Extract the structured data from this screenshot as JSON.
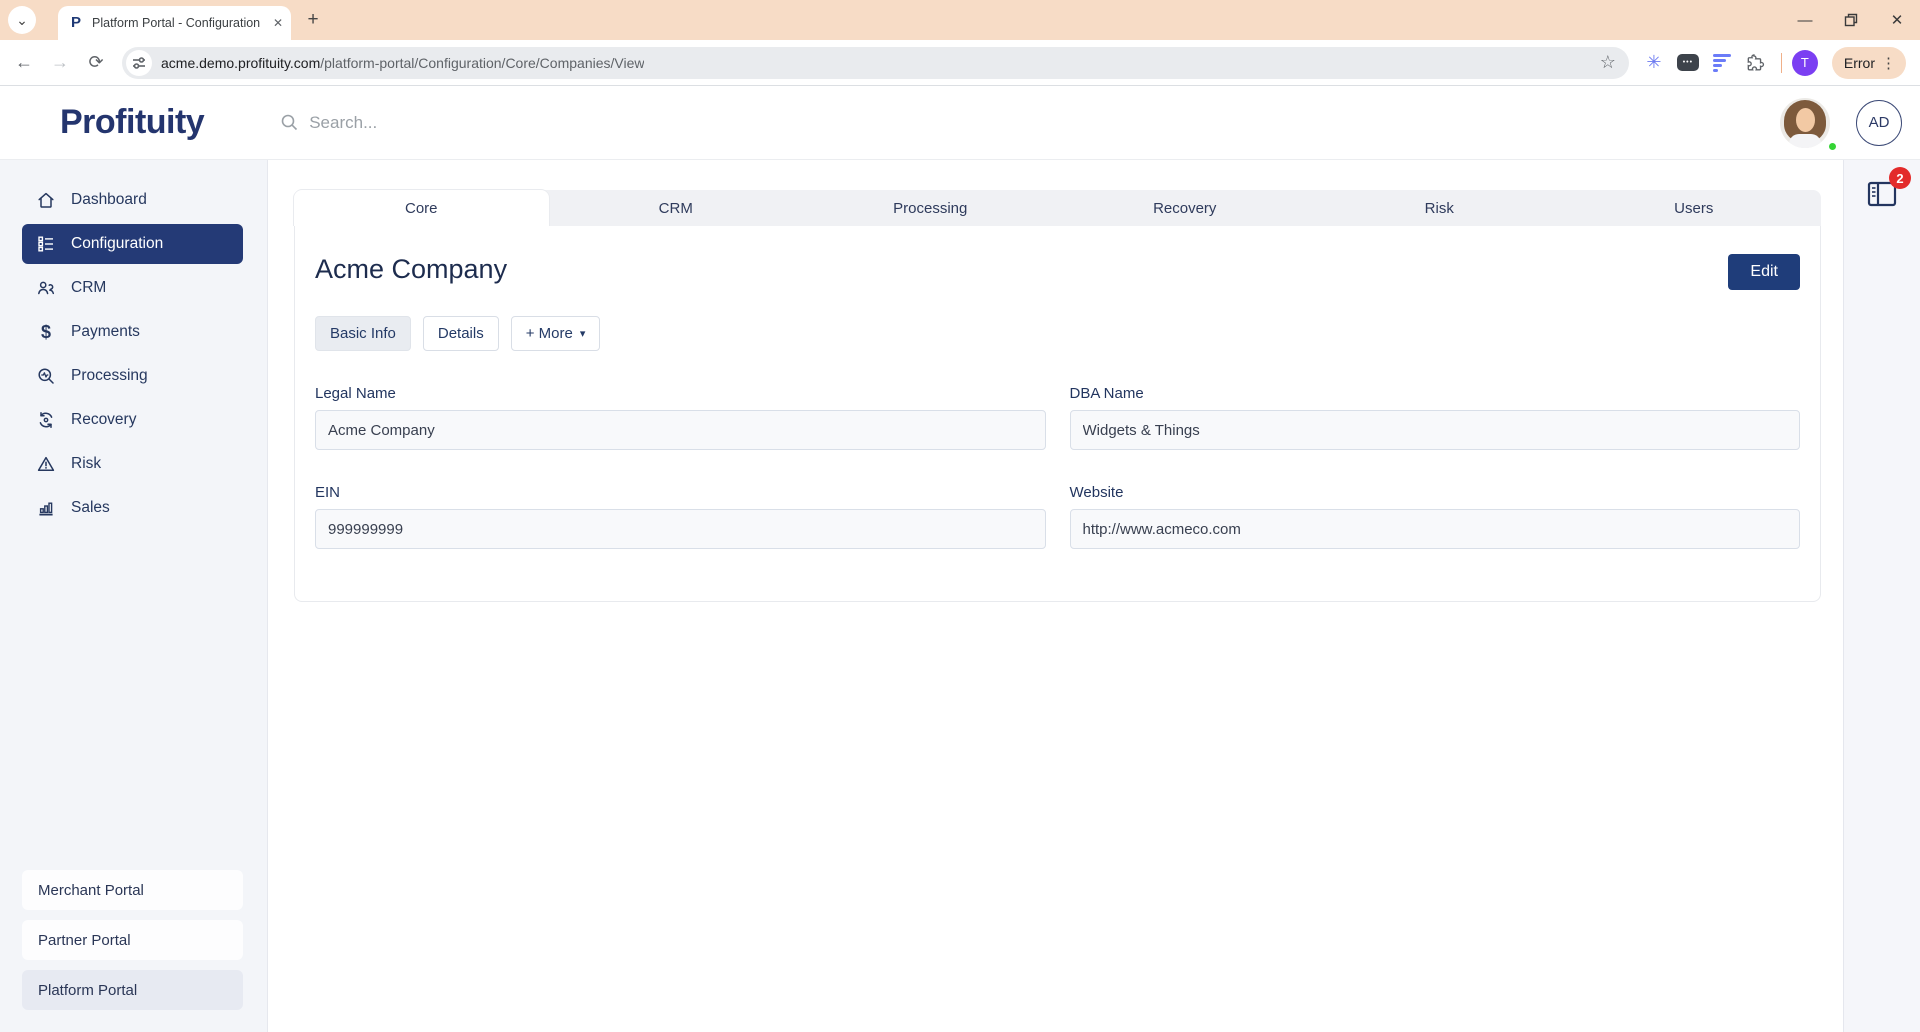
{
  "browser": {
    "tab_title": "Platform Portal - Configuration",
    "favicon_letter": "P",
    "url_domain": "acme.demo.profituity.com",
    "url_path": "/platform-portal/Configuration/Core/Companies/View",
    "profile_initial": "T",
    "error_label": "Error",
    "icons": {
      "tab_search_chevron": "⌄",
      "tab_close": "✕",
      "new_tab": "+",
      "back": "←",
      "forward": "→",
      "reload": "⟳",
      "star": "☆",
      "asterisk_extension": "✳",
      "captions_dots": "•••",
      "minimize": "—",
      "close_window": "✕",
      "menu_dots": "⋮"
    },
    "theme_color": "#f7dcc6"
  },
  "header": {
    "logo": "Profituity",
    "search_placeholder": "Search...",
    "user_initials": "AD"
  },
  "sidebar": {
    "items": [
      {
        "label": "Dashboard",
        "icon": "home-icon",
        "active": false
      },
      {
        "label": "Configuration",
        "icon": "config-list-icon",
        "active": true
      },
      {
        "label": "CRM",
        "icon": "people-icon",
        "active": false
      },
      {
        "label": "Payments",
        "icon": "dollar-icon",
        "active": false
      },
      {
        "label": "Processing",
        "icon": "search-pulse-icon",
        "active": false
      },
      {
        "label": "Recovery",
        "icon": "recycle-gear-icon",
        "active": false
      },
      {
        "label": "Risk",
        "icon": "warning-triangle-icon",
        "active": false
      },
      {
        "label": "Sales",
        "icon": "bar-chart-icon",
        "active": false
      }
    ],
    "icon_glyphs": {
      "dollar": "$"
    },
    "portals": [
      {
        "label": "Merchant Portal",
        "active": false
      },
      {
        "label": "Partner Portal",
        "active": false
      },
      {
        "label": "Platform Portal",
        "active": true
      }
    ]
  },
  "main": {
    "tabs": [
      {
        "label": "Core",
        "active": true
      },
      {
        "label": "CRM",
        "active": false
      },
      {
        "label": "Processing",
        "active": false
      },
      {
        "label": "Recovery",
        "active": false
      },
      {
        "label": "Risk",
        "active": false
      },
      {
        "label": "Users",
        "active": false
      }
    ],
    "company_name": "Acme Company",
    "edit_button": "Edit",
    "section_buttons": [
      {
        "label": "Basic Info",
        "active": true
      },
      {
        "label": "Details",
        "active": false
      },
      {
        "label": "+ More",
        "active": false,
        "dropdown_caret": "▾"
      }
    ],
    "fields": [
      {
        "label": "Legal Name",
        "value": "Acme Company"
      },
      {
        "label": "DBA Name",
        "value": "Widgets & Things"
      },
      {
        "label": "EIN",
        "value": "999999999"
      },
      {
        "label": "Website",
        "value": "http://www.acmeco.com"
      }
    ]
  },
  "right_panel": {
    "badge_count": "2"
  },
  "colors": {
    "navy_primary": "#243a76",
    "edit_button": "#1f3d7a",
    "badge_red": "#e32b2b",
    "browser_theme_peach": "#f7dcc6",
    "sidebar_bg": "#f3f5f9",
    "input_bg": "#f8f9fb",
    "online_green": "#35d435"
  }
}
